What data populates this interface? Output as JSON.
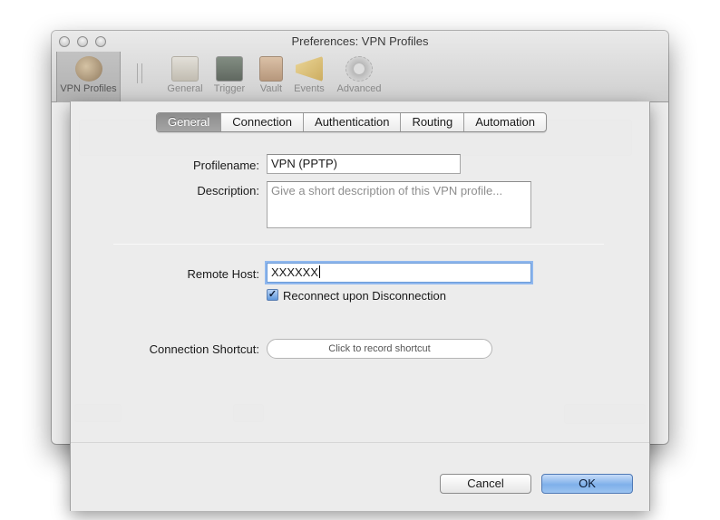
{
  "window": {
    "title": "Preferences: VPN Profiles",
    "toolbar": [
      {
        "label": "VPN Profiles",
        "icon": "network-globe-icon",
        "active": true
      },
      {
        "label": "General",
        "icon": "general-switch-icon"
      },
      {
        "label": "Trigger",
        "icon": "trigger-monitor-icon"
      },
      {
        "label": "Vault",
        "icon": "vault-safe-icon"
      },
      {
        "label": "Events",
        "icon": "megaphone-icon"
      },
      {
        "label": "Advanced",
        "icon": "gear-icon"
      }
    ]
  },
  "sheet": {
    "tabs": [
      {
        "label": "General",
        "selected": true
      },
      {
        "label": "Connection"
      },
      {
        "label": "Authentication"
      },
      {
        "label": "Routing"
      },
      {
        "label": "Automation"
      }
    ],
    "profilename": {
      "label": "Profilename:",
      "value": "VPN (PPTP)"
    },
    "description": {
      "label": "Description:",
      "placeholder": "Give a short description of this VPN profile..."
    },
    "remote_host": {
      "label": "Remote Host:",
      "value": "XXXXXX"
    },
    "reconnect": {
      "label": "Reconnect upon Disconnection",
      "checked": true
    },
    "shortcut": {
      "label": "Connection Shortcut:",
      "placeholder": "Click to record shortcut"
    },
    "buttons": {
      "cancel": "Cancel",
      "ok": "OK"
    }
  },
  "colors": {
    "ok_button": "#7fb0ea",
    "focus_ring": "#90b8ee",
    "selected_tab": "#8c8c8c"
  }
}
